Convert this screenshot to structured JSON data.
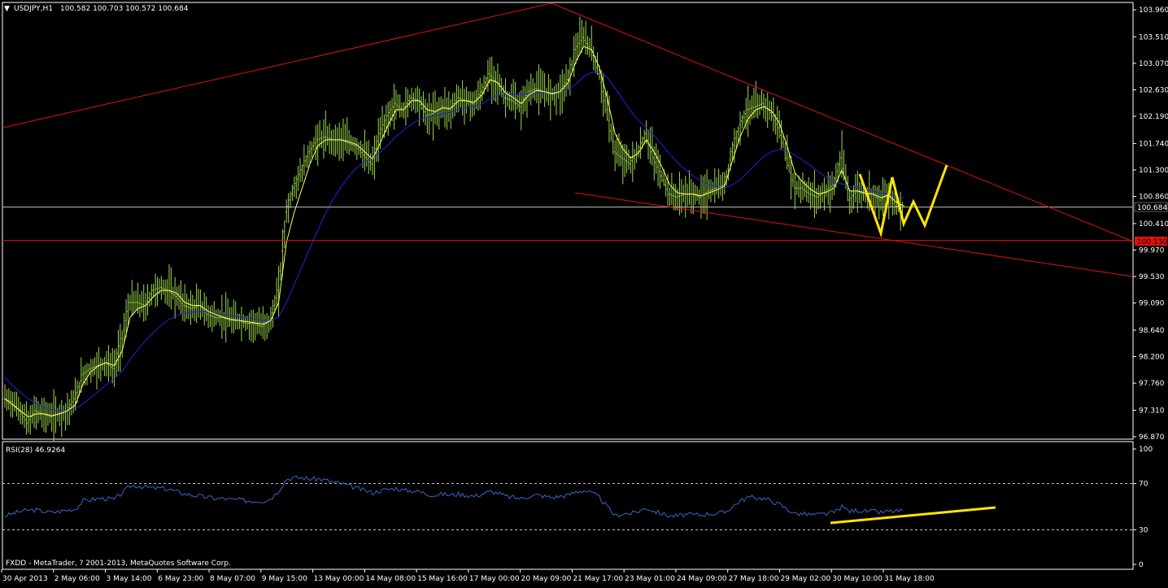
{
  "header": {
    "symbol_label": "USDJPY,H1",
    "ohlc": "100.582 100.703 100.572 100.684"
  },
  "footer": {
    "copyright": "FXDD - MetaTrader, ? 2001-2013, MetaQuotes Software Corp."
  },
  "colors": {
    "background": "#000000",
    "frame": "#ffffff",
    "candles": "#9bd84a",
    "ma_fast": "#ffff66",
    "ma_slow": "#2222dd",
    "trendline": "#e01010",
    "projection": "#ffe600",
    "rsi_line": "#3a64c8",
    "current_price_line": "#c0c0c0",
    "red_level_badge": "#e01010"
  },
  "chart_data": [
    {
      "type": "line",
      "name": "price",
      "y_ticks": [
        "103.960",
        "103.510",
        "103.070",
        "102.630",
        "102.190",
        "101.740",
        "101.300",
        "100.860",
        "100.410",
        "99.970",
        "99.530",
        "99.090",
        "98.640",
        "98.200",
        "97.760",
        "97.310",
        "96.870"
      ],
      "ylim": [
        96.87,
        103.96
      ],
      "x_labels": [
        "30 Apr 2013",
        "2 May 06:00",
        "3 May 14:00",
        "6 May 23:00",
        "8 May 07:00",
        "9 May 15:00",
        "13 May 00:00",
        "14 May 08:00",
        "15 May 16:00",
        "17 May 00:00",
        "20 May 09:00",
        "21 May 17:00",
        "23 May 01:00",
        "24 May 09:00",
        "27 May 18:00",
        "29 May 02:00",
        "30 May 10:00",
        "31 May 18:00"
      ],
      "current_price": "100.684",
      "red_level": "100.130",
      "price_path": [
        97.5,
        97.45,
        97.3,
        97.1,
        97.3,
        97.25,
        97.2,
        97.25,
        97.3,
        97.5,
        97.9,
        98.0,
        98.05,
        98.1,
        98.0,
        98.5,
        99.1,
        99.1,
        99.05,
        99.3,
        99.35,
        99.3,
        99.2,
        99.05,
        99.0,
        99.05,
        98.9,
        98.85,
        98.85,
        98.8,
        98.8,
        98.75,
        98.75,
        98.7,
        98.8,
        99.3,
        100.6,
        101.0,
        101.3,
        101.6,
        101.8,
        101.85,
        101.8,
        101.8,
        101.75,
        101.7,
        101.55,
        101.4,
        101.9,
        102.2,
        102.4,
        102.3,
        102.5,
        102.45,
        102.2,
        102.25,
        102.35,
        102.3,
        102.5,
        102.45,
        102.4,
        102.6,
        102.9,
        102.75,
        102.5,
        102.45,
        102.35,
        102.6,
        102.65,
        102.6,
        102.55,
        102.6,
        102.8,
        103.3,
        103.5,
        103.3,
        102.9,
        102.3,
        101.6,
        101.5,
        101.4,
        101.6,
        101.9,
        101.5,
        101.2,
        100.9,
        100.85,
        100.9,
        100.9,
        100.85,
        100.95,
        101.0,
        101.05,
        101.6,
        102.05,
        102.3,
        102.35,
        102.4,
        102.25,
        102.0,
        101.5,
        101.0,
        101.0,
        100.9,
        100.85,
        100.95,
        101.05,
        101.5,
        100.8,
        100.95,
        100.9,
        100.9,
        100.8,
        100.9,
        100.7,
        100.684
      ],
      "ma_fast_path": [
        97.5,
        97.4,
        97.3,
        97.2,
        97.25,
        97.25,
        97.22,
        97.25,
        97.3,
        97.4,
        97.75,
        97.95,
        98.05,
        98.1,
        98.05,
        98.3,
        98.85,
        99.0,
        99.05,
        99.2,
        99.3,
        99.3,
        99.25,
        99.1,
        99.05,
        99.05,
        98.95,
        98.9,
        98.85,
        98.82,
        98.8,
        98.78,
        98.76,
        98.74,
        98.8,
        99.1,
        100.1,
        100.6,
        101.0,
        101.4,
        101.7,
        101.8,
        101.8,
        101.8,
        101.77,
        101.72,
        101.6,
        101.48,
        101.75,
        102.05,
        102.3,
        102.3,
        102.45,
        102.45,
        102.3,
        102.27,
        102.33,
        102.32,
        102.45,
        102.45,
        102.42,
        102.55,
        102.8,
        102.75,
        102.58,
        102.5,
        102.4,
        102.55,
        102.62,
        102.6,
        102.57,
        102.6,
        102.75,
        103.1,
        103.35,
        103.3,
        103.0,
        102.5,
        101.9,
        101.65,
        101.5,
        101.58,
        101.8,
        101.6,
        101.35,
        101.05,
        100.92,
        100.9,
        100.9,
        100.87,
        100.92,
        100.97,
        101.03,
        101.45,
        101.85,
        102.15,
        102.3,
        102.35,
        102.28,
        102.08,
        101.7,
        101.25,
        101.1,
        100.98,
        100.9,
        100.93,
        101.0,
        101.3,
        100.95,
        100.95,
        100.92,
        100.9,
        100.84,
        100.88,
        100.76,
        100.7
      ],
      "ma_slow_path": [
        97.85,
        97.72,
        97.6,
        97.5,
        97.42,
        97.36,
        97.32,
        97.3,
        97.3,
        97.33,
        97.42,
        97.52,
        97.63,
        97.74,
        97.83,
        97.96,
        98.15,
        98.32,
        98.47,
        98.6,
        98.72,
        98.82,
        98.88,
        98.92,
        98.94,
        98.95,
        98.94,
        98.92,
        98.9,
        98.88,
        98.86,
        98.84,
        98.82,
        98.8,
        98.8,
        98.86,
        99.1,
        99.4,
        99.7,
        100.0,
        100.3,
        100.58,
        100.82,
        101.02,
        101.2,
        101.34,
        101.44,
        101.5,
        101.6,
        101.72,
        101.86,
        101.96,
        102.06,
        102.14,
        102.18,
        102.2,
        102.23,
        102.26,
        102.3,
        102.33,
        102.36,
        102.4,
        102.48,
        102.54,
        102.56,
        102.56,
        102.55,
        102.56,
        102.58,
        102.59,
        102.6,
        102.6,
        102.64,
        102.73,
        102.85,
        102.92,
        102.92,
        102.84,
        102.66,
        102.47,
        102.28,
        102.12,
        102.0,
        101.87,
        101.72,
        101.56,
        101.42,
        101.3,
        101.2,
        101.12,
        101.06,
        101.02,
        101.0,
        101.05,
        101.14,
        101.27,
        101.4,
        101.52,
        101.6,
        101.64,
        101.62,
        101.55,
        101.46,
        101.37,
        101.27,
        101.18,
        101.1,
        101.07,
        101.03,
        101.0,
        100.97,
        100.95,
        100.92,
        100.9,
        100.87,
        100.84
      ]
    },
    {
      "type": "line",
      "name": "RSI(28)",
      "label": "RSI(28) 46.9264",
      "y_ticks": [
        "100",
        "70",
        "30",
        "0"
      ],
      "ylim": [
        0,
        100
      ],
      "levels": [
        70,
        30
      ],
      "values": [
        42,
        44,
        46,
        47,
        47,
        46,
        45,
        46,
        47,
        48,
        55,
        56,
        57,
        57,
        56,
        62,
        68,
        68,
        67,
        66,
        66,
        65,
        63,
        61,
        60,
        59,
        58,
        57,
        57,
        56,
        56,
        55,
        55,
        55,
        57,
        64,
        74,
        75,
        75,
        74,
        74,
        73,
        71,
        70,
        68,
        66,
        64,
        62,
        64,
        65,
        66,
        64,
        64,
        63,
        61,
        60,
        61,
        60,
        61,
        60,
        59,
        61,
        63,
        62,
        59,
        58,
        57,
        59,
        60,
        59,
        58,
        59,
        60,
        63,
        64,
        62,
        58,
        50,
        42,
        44,
        44,
        46,
        49,
        46,
        44,
        42,
        42,
        43,
        43,
        43,
        44,
        44,
        45,
        50,
        55,
        58,
        58,
        57,
        55,
        52,
        48,
        44,
        44,
        43,
        43,
        44,
        45,
        50,
        46,
        47,
        46,
        46,
        45,
        46,
        46,
        46.9
      ]
    }
  ],
  "annotations": {
    "trendlines": "red channel lines and horizontal level",
    "projection": "yellow zig-zag and RSI support line"
  }
}
